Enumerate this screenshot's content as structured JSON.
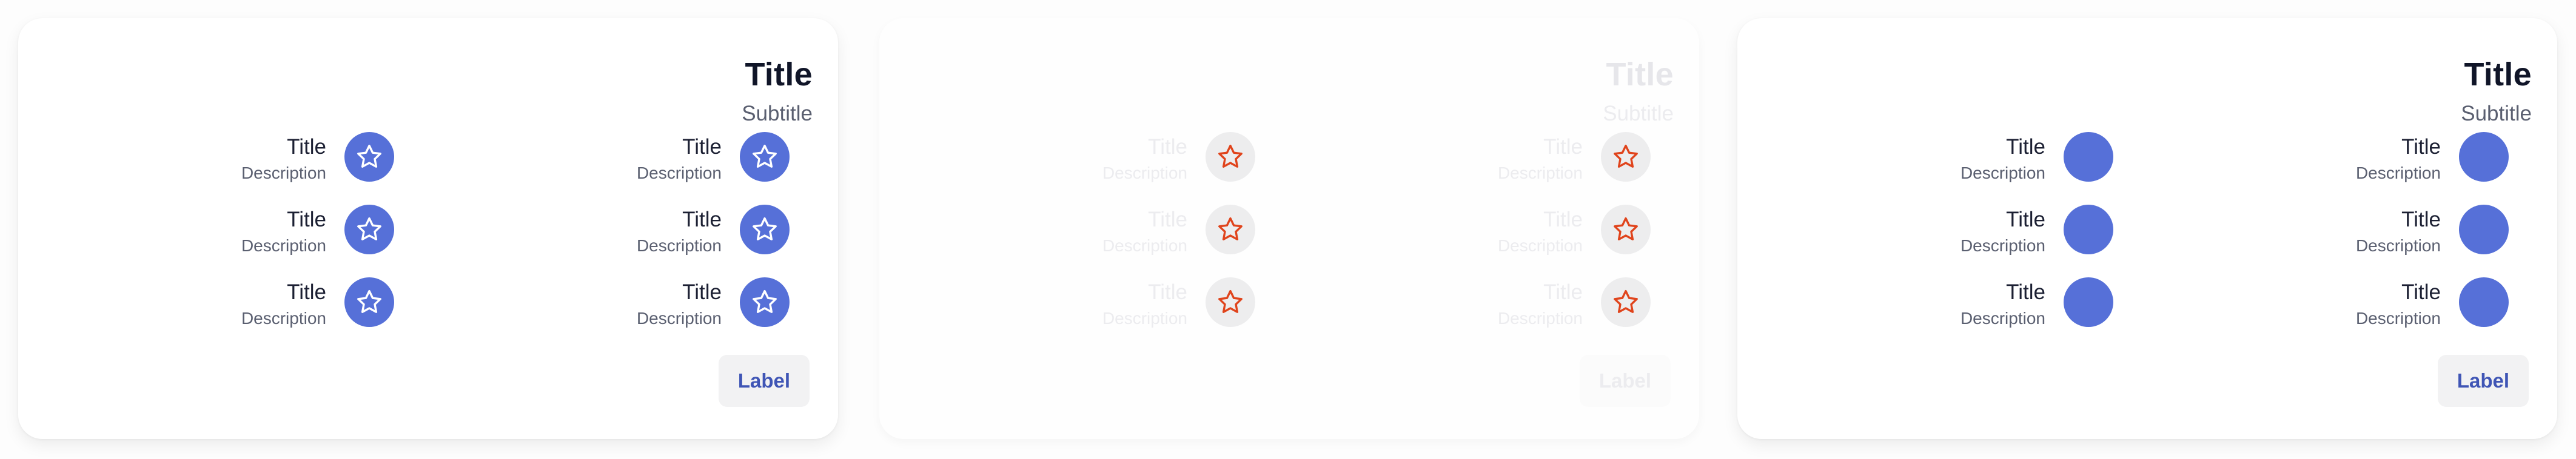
{
  "colors": {
    "accent": "#5670d8",
    "button_text": "#3f55b5",
    "star_disabled": "#e0441c"
  },
  "cards": [
    {
      "state": "default",
      "title": "Title",
      "subtitle": "Subtitle",
      "icon": "star-icon",
      "features": [
        {
          "title": "Title",
          "description": "Description"
        },
        {
          "title": "Title",
          "description": "Description"
        },
        {
          "title": "Title",
          "description": "Description"
        },
        {
          "title": "Title",
          "description": "Description"
        },
        {
          "title": "Title",
          "description": "Description"
        },
        {
          "title": "Title",
          "description": "Description"
        }
      ],
      "button_label": "Label"
    },
    {
      "state": "disabled",
      "title": "Title",
      "subtitle": "Subtitle",
      "icon": "star-icon",
      "features": [
        {
          "title": "Title",
          "description": "Description"
        },
        {
          "title": "Title",
          "description": "Description"
        },
        {
          "title": "Title",
          "description": "Description"
        },
        {
          "title": "Title",
          "description": "Description"
        },
        {
          "title": "Title",
          "description": "Description"
        },
        {
          "title": "Title",
          "description": "Description"
        }
      ],
      "button_label": "Label"
    },
    {
      "state": "no-icon",
      "title": "Title",
      "subtitle": "Subtitle",
      "icon": "circle-placeholder",
      "features": [
        {
          "title": "Title",
          "description": "Description"
        },
        {
          "title": "Title",
          "description": "Description"
        },
        {
          "title": "Title",
          "description": "Description"
        },
        {
          "title": "Title",
          "description": "Description"
        },
        {
          "title": "Title",
          "description": "Description"
        },
        {
          "title": "Title",
          "description": "Description"
        }
      ],
      "button_label": "Label"
    }
  ]
}
